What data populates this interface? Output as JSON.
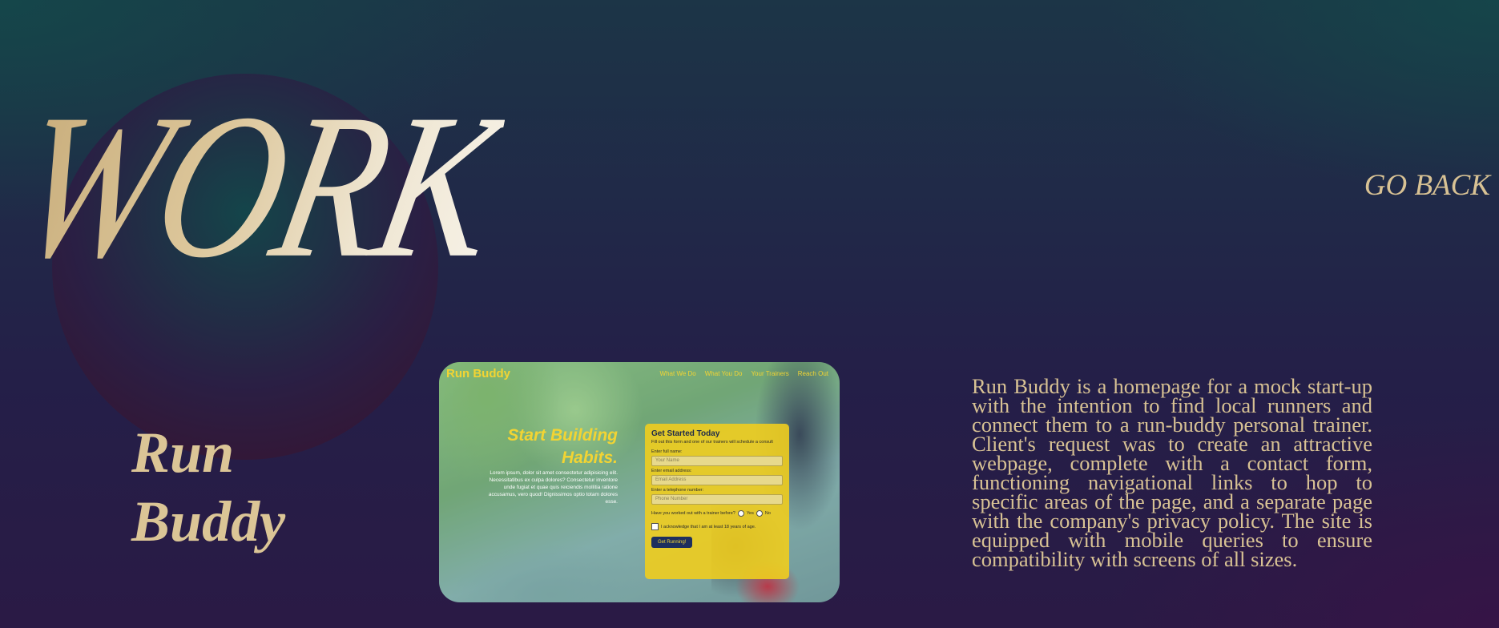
{
  "page": {
    "title": "WORK",
    "go_back": "GO BACK"
  },
  "project": {
    "name_line1": "Run",
    "name_line2": "Buddy",
    "description": "Run Buddy is a homepage for a mock start-up with the intention to find local runners and connect them to a run-buddy personal trainer. Client's request was to create an attractive webpage, complete with a contact form, functioning navigational links to hop to specific areas of the page, and a separate page with the company's privacy policy. The site is equipped with mobile queries to ensure compatibility with screens of all sizes."
  },
  "screenshot": {
    "brand": "Run Buddy",
    "nav": [
      "What We Do",
      "What You Do",
      "Your Trainers",
      "Reach Out"
    ],
    "hero_title": "Start Building Habits.",
    "hero_text": "Lorem ipsum, dolor sit amet consectetur adipisicing elit. Necessitatibus ex culpa dolores? Consectetur inventore unde fugiat et quae quis reiciendis mollitia ratione accusamus, vero quod! Dignissimos optio totam dolores esse.",
    "form": {
      "title": "Get Started Today",
      "subtitle": "Fill out this form and one of our trainers will schedule a consult",
      "name_label": "Enter full name:",
      "name_placeholder": "Your Name",
      "email_label": "Enter email address:",
      "email_placeholder": "Email Address",
      "phone_label": "Enter a telephone number:",
      "phone_placeholder": "Phone Number",
      "question": "Have you worked out with a trainer before?",
      "yes": "Yes",
      "no": "No",
      "acknowledge": "I acknowledge that I am at least 18 years of age.",
      "submit": "Get Running!"
    }
  },
  "colors": {
    "accent_gold": "#d8c294",
    "runbuddy_yellow": "#f2d433",
    "runbuddy_navy": "#1d2f5e"
  }
}
